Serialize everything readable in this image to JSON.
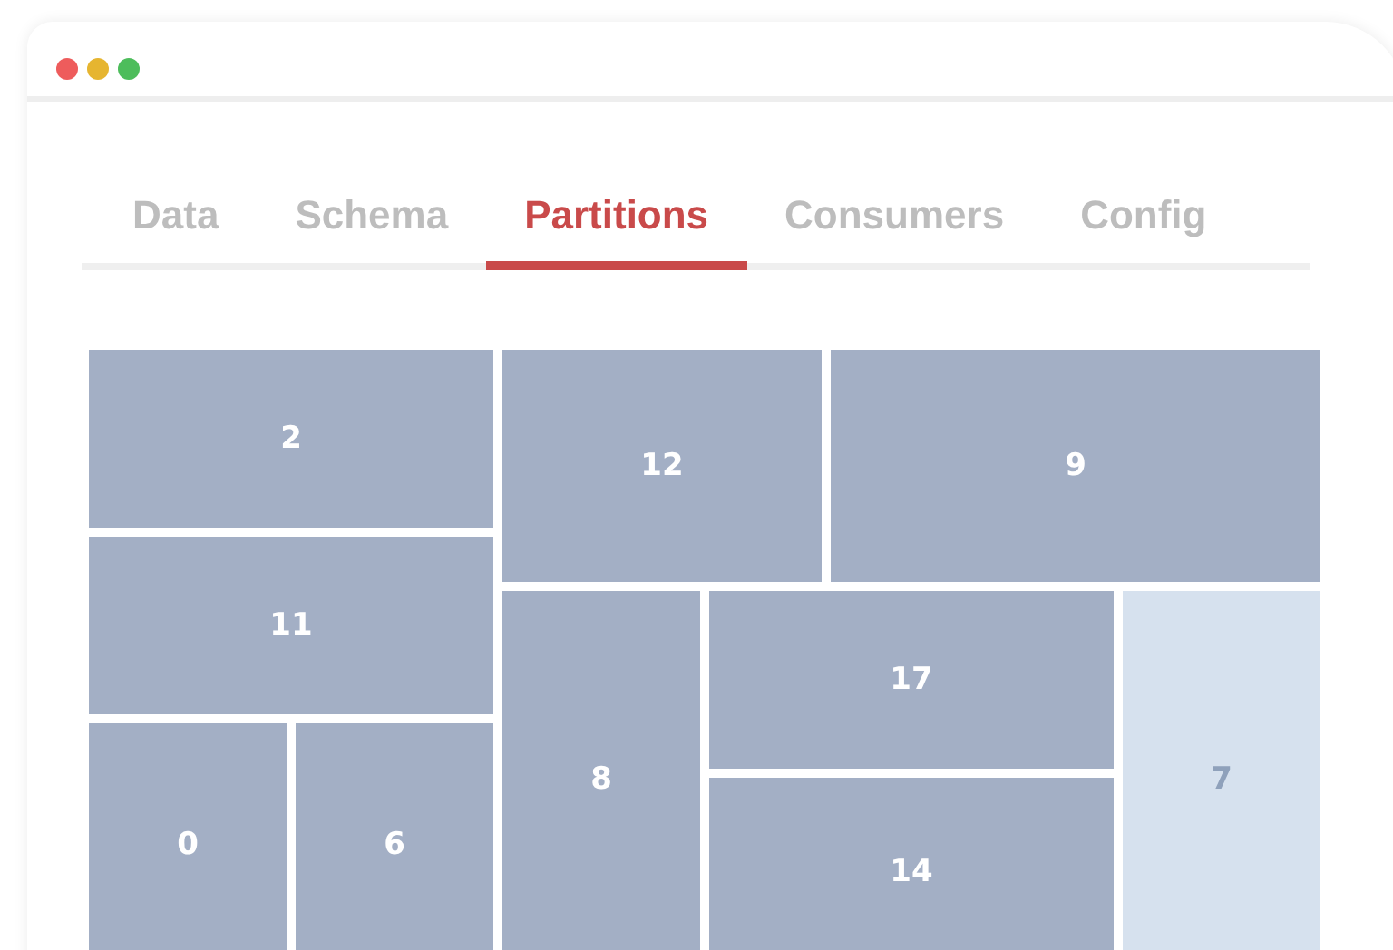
{
  "tabs": [
    {
      "label": "Data",
      "selected": false
    },
    {
      "label": "Schema",
      "selected": false
    },
    {
      "label": "Partitions",
      "selected": true
    },
    {
      "label": "Consumers",
      "selected": false
    },
    {
      "label": "Config",
      "selected": false
    }
  ],
  "partitions": [
    {
      "label": "2",
      "selected": false
    },
    {
      "label": "11",
      "selected": false
    },
    {
      "label": "0",
      "selected": false
    },
    {
      "label": "6",
      "selected": false
    },
    {
      "label": "12",
      "selected": false
    },
    {
      "label": "9",
      "selected": false
    },
    {
      "label": "8",
      "selected": false
    },
    {
      "label": "17",
      "selected": false
    },
    {
      "label": "14",
      "selected": false
    },
    {
      "label": "7",
      "selected": true
    }
  ]
}
